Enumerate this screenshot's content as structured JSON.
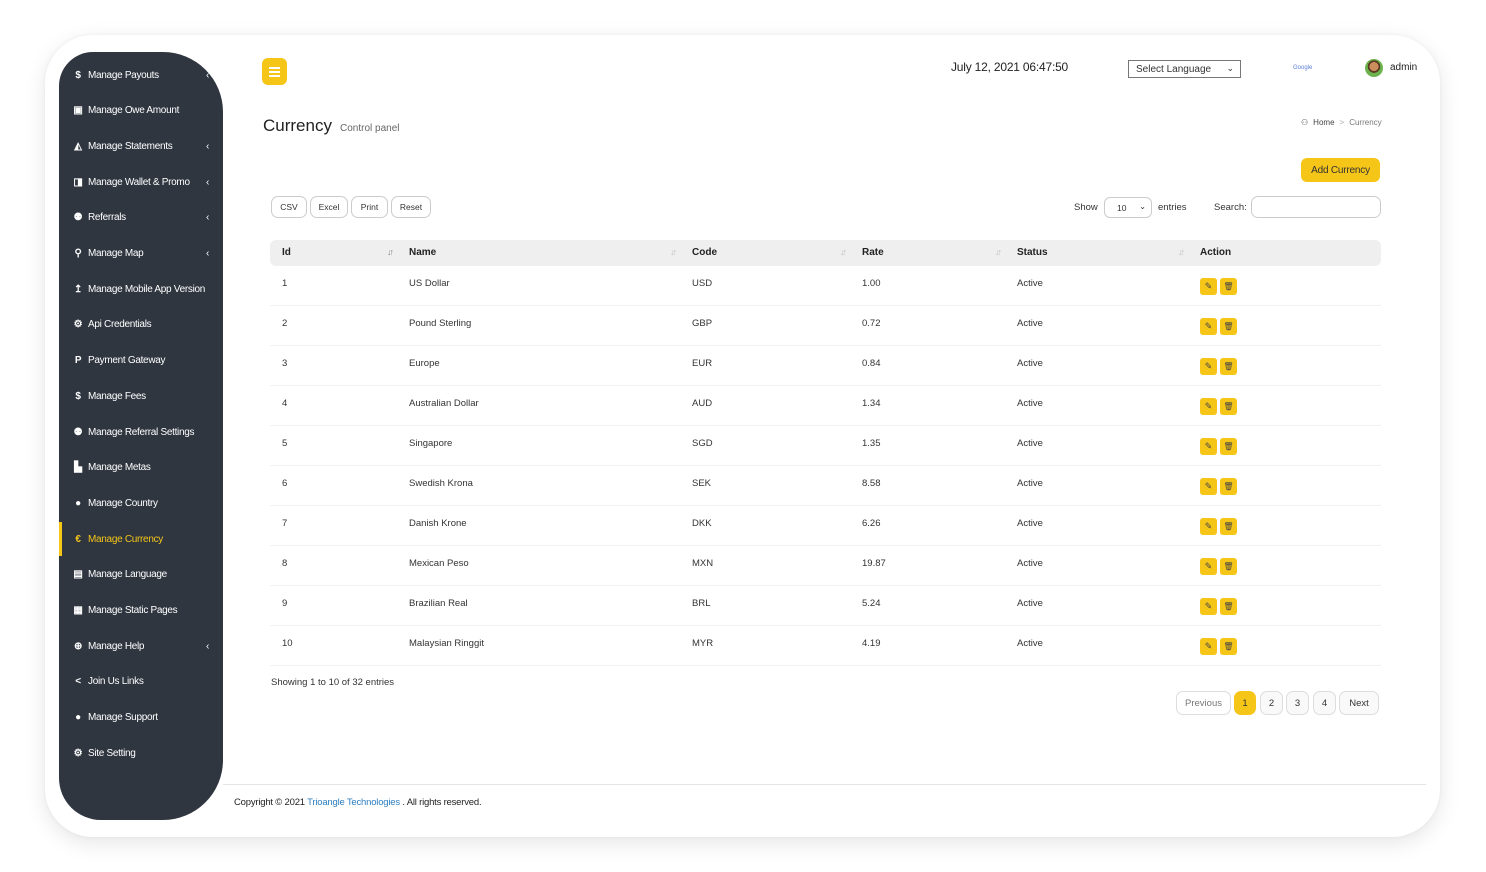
{
  "sidebar": {
    "items": [
      {
        "label": "Manage Payouts",
        "icon": "dollar-icon",
        "glyph": "$",
        "expandable": true
      },
      {
        "label": "Manage Owe Amount",
        "icon": "money-icon",
        "glyph": "▣",
        "expandable": false
      },
      {
        "label": "Manage Statements",
        "icon": "area-chart-icon",
        "glyph": "◭",
        "expandable": true
      },
      {
        "label": "Manage Wallet & Promo",
        "icon": "wallet-icon",
        "glyph": "◨",
        "expandable": true
      },
      {
        "label": "Referrals",
        "icon": "users-icon",
        "glyph": "⚉",
        "expandable": true
      },
      {
        "label": "Manage Map",
        "icon": "map-marker-icon",
        "glyph": "⚲",
        "expandable": true
      },
      {
        "label": "Manage Mobile App Version",
        "icon": "level-up-icon",
        "glyph": "↥",
        "expandable": false
      },
      {
        "label": "Api Credentials",
        "icon": "gear-icon",
        "glyph": "⚙",
        "expandable": false
      },
      {
        "label": "Payment Gateway",
        "icon": "paypal-icon",
        "glyph": "P",
        "expandable": false
      },
      {
        "label": "Manage Fees",
        "icon": "dollar-icon",
        "glyph": "$",
        "expandable": false
      },
      {
        "label": "Manage Referral Settings",
        "icon": "users-icon",
        "glyph": "⚉",
        "expandable": false
      },
      {
        "label": "Manage Metas",
        "icon": "bar-chart-icon",
        "glyph": "▙",
        "expandable": false
      },
      {
        "label": "Manage Country",
        "icon": "globe-icon",
        "glyph": "●",
        "expandable": false
      },
      {
        "label": "Manage Currency",
        "icon": "euro-icon",
        "glyph": "€",
        "expandable": false,
        "active": true
      },
      {
        "label": "Manage Language",
        "icon": "language-icon",
        "glyph": "▤",
        "expandable": false
      },
      {
        "label": "Manage Static Pages",
        "icon": "newspaper-icon",
        "glyph": "▦",
        "expandable": false
      },
      {
        "label": "Manage Help",
        "icon": "life-ring-icon",
        "glyph": "⊕",
        "expandable": true
      },
      {
        "label": "Join Us Links",
        "icon": "share-icon",
        "glyph": "<",
        "expandable": false
      },
      {
        "label": "Manage Support",
        "icon": "globe-icon",
        "glyph": "●",
        "expandable": false
      },
      {
        "label": "Site Setting",
        "icon": "gears-icon",
        "glyph": "⚙",
        "expandable": false
      }
    ]
  },
  "header": {
    "datetime": "July 12, 2021 06:47:50",
    "language_select": "Select Language",
    "google_label": "Google",
    "user": "admin"
  },
  "page": {
    "title": "Currency",
    "subtitle": "Control panel",
    "breadcrumb": [
      "Home",
      "Currency"
    ],
    "add_button": "Add Currency"
  },
  "toolbar": {
    "buttons": [
      "CSV",
      "Excel",
      "Print",
      "Reset"
    ],
    "show_label": "Show",
    "page_length": "10",
    "entries_label": "entries",
    "search_label": "Search:",
    "search_value": ""
  },
  "table": {
    "columns": [
      "Id",
      "Name",
      "Code",
      "Rate",
      "Status",
      "Action"
    ],
    "rows": [
      {
        "id": "1",
        "name": "US Dollar",
        "code": "USD",
        "rate": "1.00",
        "status": "Active"
      },
      {
        "id": "2",
        "name": "Pound Sterling",
        "code": "GBP",
        "rate": "0.72",
        "status": "Active"
      },
      {
        "id": "3",
        "name": "Europe",
        "code": "EUR",
        "rate": "0.84",
        "status": "Active"
      },
      {
        "id": "4",
        "name": "Australian Dollar",
        "code": "AUD",
        "rate": "1.34",
        "status": "Active"
      },
      {
        "id": "5",
        "name": "Singapore",
        "code": "SGD",
        "rate": "1.35",
        "status": "Active"
      },
      {
        "id": "6",
        "name": "Swedish Krona",
        "code": "SEK",
        "rate": "8.58",
        "status": "Active"
      },
      {
        "id": "7",
        "name": "Danish Krone",
        "code": "DKK",
        "rate": "6.26",
        "status": "Active"
      },
      {
        "id": "8",
        "name": "Mexican Peso",
        "code": "MXN",
        "rate": "19.87",
        "status": "Active"
      },
      {
        "id": "9",
        "name": "Brazilian Real",
        "code": "BRL",
        "rate": "5.24",
        "status": "Active"
      },
      {
        "id": "10",
        "name": "Malaysian Ringgit",
        "code": "MYR",
        "rate": "4.19",
        "status": "Active"
      }
    ],
    "info": "Showing 1 to 10 of 32 entries"
  },
  "pagination": {
    "previous": "Previous",
    "pages": [
      "1",
      "2",
      "3",
      "4"
    ],
    "current": "1",
    "next": "Next"
  },
  "footer": {
    "prefix": "Copyright © 2021 ",
    "company": "Trioangle Technologies",
    "suffix": " . All rights reserved."
  },
  "colors": {
    "accent": "#f5c518",
    "sidebar_bg": "#2f3640",
    "link": "#2d7fc1"
  }
}
